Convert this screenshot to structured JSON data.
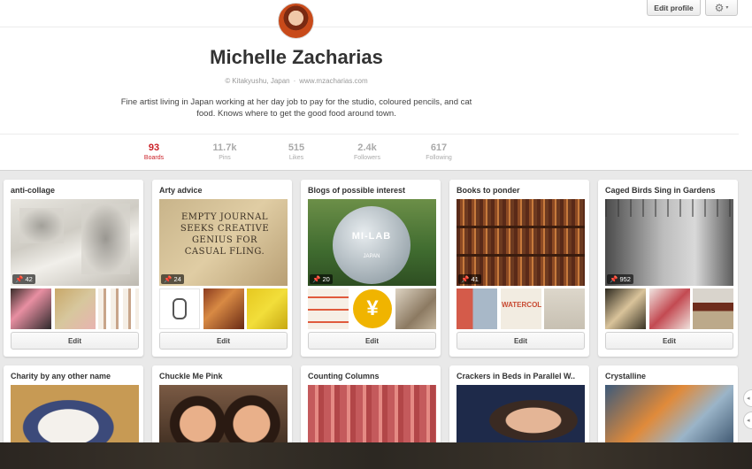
{
  "header": {
    "edit_profile_label": "Edit profile",
    "settings_icon": "gear-icon",
    "settings_caret": "▾"
  },
  "profile": {
    "name": "Michelle Zacharias",
    "location": "Kitakyushu, Japan",
    "website": "www.mzacharias.com",
    "bio": "Fine artist living in Japan working at her day job to pay for the studio, coloured pencils, and cat food. Knows where to get the good food around town."
  },
  "stats": [
    {
      "value": "93",
      "label": "Boards",
      "active": true
    },
    {
      "value": "11.7k",
      "label": "Pins"
    },
    {
      "value": "515",
      "label": "Likes"
    },
    {
      "value": "2.4k",
      "label": "Followers"
    },
    {
      "value": "617",
      "label": "Following"
    }
  ],
  "boards": [
    {
      "title": "anti-collage",
      "pin_count": "42",
      "edit_label": "Edit"
    },
    {
      "title": "Arty advice",
      "pin_count": "24",
      "edit_label": "Edit",
      "cover_text": "EMPTY JOURNAL SEEKS CREATIVE GENIUS FOR CASUAL FLING."
    },
    {
      "title": "Blogs of possible interest",
      "pin_count": "20",
      "edit_label": "Edit",
      "cover_text": "MI-LAB",
      "cover_subtext": "JAPAN",
      "thumb_text": "¥"
    },
    {
      "title": "Books to ponder",
      "pin_count": "41",
      "edit_label": "Edit",
      "thumb_text": "WATERCOLO"
    },
    {
      "title": "Caged Birds Sing in Gardens",
      "pin_count": "952",
      "edit_label": "Edit"
    },
    {
      "title": "Charity by any other name"
    },
    {
      "title": "Chuckle Me Pink"
    },
    {
      "title": "Counting Columns"
    },
    {
      "title": "Crackers in Beds in Parallel W.."
    },
    {
      "title": "Crystalline"
    }
  ],
  "colors": {
    "accent_red": "#cb2027",
    "stat_gray": "#aaaaaa"
  }
}
